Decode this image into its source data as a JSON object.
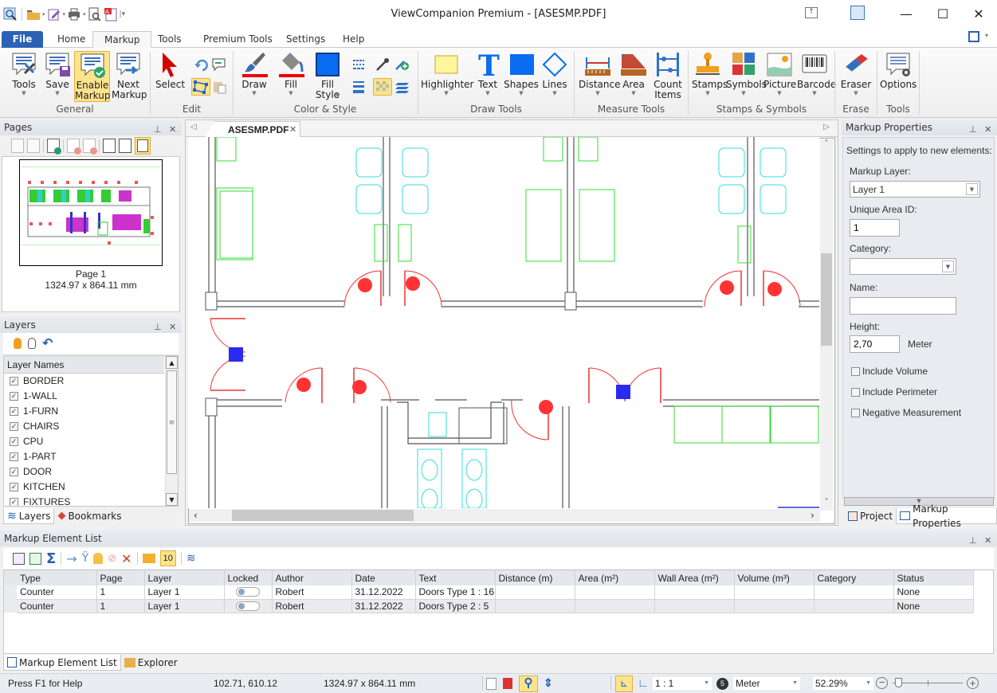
{
  "window": {
    "title": "ViewCompanion Premium - [ASESMP.PDF]",
    "controls": [
      "minimize",
      "maximize",
      "close"
    ]
  },
  "quick_access": [
    "app-icon",
    "open-folder-icon",
    "edit-markup-icon",
    "print-icon",
    "print-preview-icon",
    "pdf-export-icon",
    "customize-qat-icon"
  ],
  "tabs": [
    {
      "label": "File",
      "active": false
    },
    {
      "label": "Home",
      "active": false
    },
    {
      "label": "Markup",
      "active": true
    },
    {
      "label": "Tools",
      "active": false
    },
    {
      "label": "Premium Tools",
      "active": false
    },
    {
      "label": "Settings",
      "active": false
    },
    {
      "label": "Help",
      "active": false
    }
  ],
  "ribbon": {
    "groups": [
      {
        "label": "General",
        "buttons": [
          {
            "label": "Tools",
            "icon": "markup-tools-icon",
            "dropdown": true
          },
          {
            "label": "Save",
            "icon": "save-markup-icon",
            "dropdown": true
          },
          {
            "label": "Enable Markup",
            "icon": "enable-markup-icon",
            "active": true
          },
          {
            "label": "Next Markup",
            "icon": "next-markup-icon"
          }
        ]
      },
      {
        "label": "Edit",
        "buttons": [
          {
            "label": "Select",
            "icon": "select-arrow-icon"
          },
          {
            "label": "",
            "icon": "undo-icon"
          },
          {
            "label": "",
            "icon": "comment-icon"
          },
          {
            "label": "",
            "icon": "edit-points-icon",
            "active": true
          },
          {
            "label": "",
            "icon": "paste-icon"
          }
        ]
      },
      {
        "label": "Color & Style",
        "buttons": [
          {
            "label": "Draw",
            "icon": "draw-brush-icon",
            "dropdown": true
          },
          {
            "label": "Fill",
            "icon": "fill-bucket-icon",
            "dropdown": true
          },
          {
            "label": "Fill Style",
            "icon": "fill-style-icon",
            "dropdown": true
          },
          {
            "label": "",
            "icon": "line-style-icon"
          },
          {
            "label": "",
            "icon": "eyedropper-icon"
          },
          {
            "label": "",
            "icon": "add-color-icon"
          },
          {
            "label": "",
            "icon": "line-width-icon"
          },
          {
            "label": "",
            "icon": "transparency-icon",
            "active": true
          },
          {
            "label": "",
            "icon": "layers-icon"
          }
        ]
      },
      {
        "label": "Draw Tools",
        "buttons": [
          {
            "label": "Highlighter",
            "icon": "highlighter-icon",
            "dropdown": true
          },
          {
            "label": "Text",
            "icon": "text-icon",
            "dropdown": true
          },
          {
            "label": "Shapes",
            "icon": "shapes-icon",
            "dropdown": true
          },
          {
            "label": "Lines",
            "icon": "lines-icon",
            "dropdown": true
          }
        ]
      },
      {
        "label": "Measure Tools",
        "buttons": [
          {
            "label": "Distance",
            "icon": "distance-icon",
            "dropdown": true
          },
          {
            "label": "Area",
            "icon": "area-icon",
            "dropdown": true
          },
          {
            "label": "Count Items",
            "icon": "count-items-icon"
          }
        ]
      },
      {
        "label": "Stamps & Symbols",
        "buttons": [
          {
            "label": "Stamps",
            "icon": "stamp-icon",
            "dropdown": true
          },
          {
            "label": "Symbols",
            "icon": "symbols-icon",
            "dropdown": true
          },
          {
            "label": "Picture",
            "icon": "picture-icon",
            "dropdown": true
          },
          {
            "label": "Barcode",
            "icon": "barcode-icon",
            "dropdown": true
          }
        ]
      },
      {
        "label": "Erase",
        "buttons": [
          {
            "label": "Eraser",
            "icon": "eraser-icon",
            "dropdown": true
          }
        ]
      },
      {
        "label": "Tools",
        "buttons": [
          {
            "label": "Options",
            "icon": "options-icon"
          }
        ]
      }
    ]
  },
  "pages_panel": {
    "title": "Pages",
    "page_label": "Page 1",
    "page_size": "1324.97 x 864.11 mm"
  },
  "layers_panel": {
    "title": "Layers",
    "column": "Layer Names",
    "layers": [
      {
        "name": "BORDER",
        "checked": true
      },
      {
        "name": "1-WALL",
        "checked": true
      },
      {
        "name": "1-FURN",
        "checked": true
      },
      {
        "name": "CHAIRS",
        "checked": true
      },
      {
        "name": "CPU",
        "checked": true
      },
      {
        "name": "1-PART",
        "checked": true
      },
      {
        "name": "DOOR",
        "checked": true
      },
      {
        "name": "KITCHEN",
        "checked": true
      },
      {
        "name": "FIXTURES",
        "checked": true
      }
    ],
    "bottom_tabs": [
      {
        "label": "Layers",
        "active": true
      },
      {
        "label": "Bookmarks",
        "active": false
      }
    ]
  },
  "document": {
    "tab_label": "ASESMP.PDF",
    "colors": {
      "wall": "#555555",
      "furniture": "#33dd33",
      "chairs": "#33dddd",
      "door": "#ee3333",
      "marker_red": "#ff3333",
      "marker_blue": "#2a2af0"
    }
  },
  "markup_properties": {
    "title": "Markup Properties",
    "intro": "Settings to apply to new elements:",
    "markup_layer_label": "Markup Layer:",
    "markup_layer_value": "Layer 1",
    "unique_area_id_label": "Unique Area ID:",
    "unique_area_id_value": "1",
    "category_label": "Category:",
    "category_value": "",
    "name_label": "Name:",
    "name_value": "",
    "height_label": "Height:",
    "height_value": "2,70",
    "height_unit": "Meter",
    "include_volume": {
      "label": "Include Volume",
      "checked": false
    },
    "include_perimeter": {
      "label": "Include Perimeter",
      "checked": false
    },
    "negative_measurement": {
      "label": "Negative Measurement",
      "checked": false
    },
    "bottom_tabs": [
      {
        "label": "Project",
        "active": false
      },
      {
        "label": "Markup Properties",
        "active": true
      }
    ]
  },
  "element_list": {
    "title": "Markup Element List",
    "badge_count": "10",
    "columns": [
      "Type",
      "Page",
      "Layer",
      "Locked",
      "Author",
      "Date",
      "Text",
      "Distance (m)",
      "Area (m²)",
      "Wall Area (m²)",
      "Volume (m³)",
      "Category",
      "Status"
    ],
    "rows": [
      {
        "type": "Counter",
        "page": "1",
        "layer": "Layer 1",
        "locked": false,
        "author": "Robert",
        "date": "31.12.2022",
        "text": "Doors Type 1 : 16",
        "distance": "",
        "area": "",
        "wall_area": "",
        "volume": "",
        "category": "",
        "status": "None"
      },
      {
        "type": "Counter",
        "page": "1",
        "layer": "Layer 1",
        "locked": false,
        "author": "Robert",
        "date": "31.12.2022",
        "text": "Doors Type 2 : 5",
        "distance": "",
        "area": "",
        "wall_area": "",
        "volume": "",
        "category": "",
        "status": "None"
      }
    ],
    "bottom_tabs": [
      {
        "label": "Markup Element List",
        "active": true
      },
      {
        "label": "Explorer",
        "active": false
      }
    ]
  },
  "status_bar": {
    "help": "Press F1 for Help",
    "coordinates": "102.71, 610.12",
    "page_size": "1324.97 x 864.11 mm",
    "scale": "1 : 1",
    "unit": "Meter",
    "zoom": "52.29%",
    "zoom_slider_fraction": 0.08
  }
}
